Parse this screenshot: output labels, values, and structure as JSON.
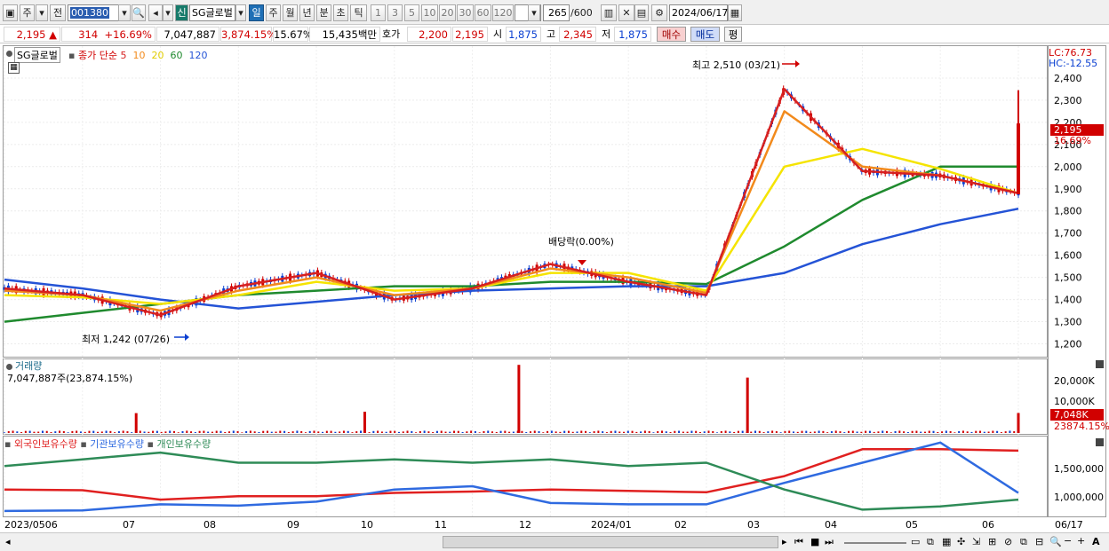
{
  "toolbar": {
    "mode_primary": "주",
    "mode_compare": "전",
    "stock_code": "001380",
    "new_badge": "신",
    "stock_name": "SG글로벌",
    "periods": [
      "일",
      "주",
      "월",
      "년",
      "분",
      "초",
      "틱"
    ],
    "active_period": "일",
    "intervals": [
      "1",
      "3",
      "5",
      "10",
      "20",
      "30",
      "60",
      "120"
    ],
    "count_value": "265",
    "count_total": "/600",
    "date": "2024/06/17"
  },
  "quote": {
    "price": "2,195",
    "change": "314",
    "change_pct": "+16.69%",
    "volume": "7,047,887",
    "volume_pct": "3,874.15%",
    "turnover": "15.67%",
    "amount": "15,435백만",
    "bid_label": "호가",
    "bid": "2,200",
    "ask": "2,195",
    "open_label": "시",
    "open": "1,875",
    "high_label": "고",
    "high": "2,345",
    "low_label": "저",
    "low": "1,875",
    "buy_label": "매수",
    "sell_label": "매도",
    "eval_label": "평"
  },
  "price_pane": {
    "legend_name": "SG글로벌",
    "legend_type": "종가 단순",
    "ma_periods": [
      "5",
      "10",
      "20",
      "60",
      "120"
    ],
    "lc": "LC:76.73",
    "hc": "HC:-12.55",
    "last_price_tag": "2,195",
    "last_pct_tag": "16.69%",
    "annot_high": "최고 2,510 (03/21)",
    "annot_low": "최저 1,242 (07/26)",
    "annot_div": "배당락(0.00%)"
  },
  "volume_pane": {
    "title": "거래량",
    "value": "7,047,887주(23,874.15%)",
    "axis": [
      "20,000K",
      "10,000K"
    ],
    "last_tag": "7,048K",
    "last_pct_tag": "23874.15%"
  },
  "holding_pane": {
    "legend": [
      "외국인보유수량",
      "기관보유수량",
      "개인보유수량"
    ],
    "axis": [
      "1,500,000",
      "1,000,000"
    ]
  },
  "date_axis": [
    "2023/0506",
    "07",
    "08",
    "09",
    "10",
    "11",
    "12",
    "2024/01",
    "02",
    "03",
    "04",
    "05",
    "06",
    "06/17"
  ],
  "colors": {
    "up": "#d10000",
    "down": "#0a3fd1",
    "ma5": "#d62020",
    "ma10": "#f28a1c",
    "ma20": "#f5e400",
    "ma60": "#1f8a2e",
    "ma120": "#2453d6",
    "foreign": "#e02020",
    "institution": "#2f6ae0",
    "individual": "#2e8b57"
  },
  "chart_data": [
    {
      "type": "line",
      "title": "SG글로벌",
      "ylim": [
        1150,
        2520
      ],
      "yticks": [
        1200,
        1300,
        1400,
        1500,
        1600,
        1700,
        1800,
        1900,
        2000,
        2100,
        2200,
        2300,
        2400
      ],
      "x": [
        "2023-05",
        "2023-06",
        "2023-07",
        "2023-08",
        "2023-09",
        "2023-10",
        "2023-11",
        "2023-12",
        "2024-01",
        "2024-02",
        "2024-03",
        "2024-04",
        "2024-05",
        "2024-06"
      ],
      "series": [
        {
          "name": "5",
          "values": [
            1450,
            1420,
            1330,
            1460,
            1520,
            1400,
            1450,
            1560,
            1480,
            1420,
            2350,
            1980,
            1960,
            1880
          ]
        },
        {
          "name": "10",
          "values": [
            1440,
            1420,
            1350,
            1440,
            1500,
            1420,
            1450,
            1540,
            1500,
            1430,
            2250,
            2000,
            1960,
            1880
          ]
        },
        {
          "name": "20",
          "values": [
            1420,
            1410,
            1380,
            1420,
            1480,
            1440,
            1450,
            1520,
            1520,
            1440,
            2000,
            2080,
            1990,
            1880
          ]
        },
        {
          "name": "60",
          "values": [
            1300,
            1340,
            1380,
            1420,
            1440,
            1460,
            1460,
            1480,
            1480,
            1470,
            1640,
            1850,
            2000,
            2000
          ]
        },
        {
          "name": "120",
          "values": [
            1490,
            1450,
            1400,
            1360,
            1390,
            1420,
            1440,
            1450,
            1460,
            1460,
            1520,
            1650,
            1740,
            1810
          ]
        }
      ],
      "high": {
        "value": 2510,
        "date": "03/21"
      },
      "low": {
        "value": 1242,
        "date": "07/26"
      },
      "last": 2195
    },
    {
      "type": "bar",
      "title": "거래량",
      "ylim": [
        0,
        25000
      ],
      "unit": "K",
      "spikes": [
        {
          "x": "2023-06-28",
          "value": 7000
        },
        {
          "x": "2023-09-28",
          "value": 7500
        },
        {
          "x": "2023-11-29",
          "value": 24000
        },
        {
          "x": "2024-02-29",
          "value": 19500
        },
        {
          "x": "2024-06-17",
          "value": 7048
        }
      ]
    },
    {
      "type": "line",
      "title": "보유수량",
      "ylim": [
        700000,
        1850000
      ],
      "x": [
        "2023-05",
        "2023-06",
        "2023-07",
        "2023-08",
        "2023-09",
        "2023-10",
        "2023-11",
        "2023-12",
        "2024-01",
        "2024-02",
        "2024-03",
        "2024-04",
        "2024-05",
        "2024-06"
      ],
      "series": [
        {
          "name": "외국인보유수량",
          "values": [
            1100000,
            1090000,
            950000,
            1000000,
            1000000,
            1050000,
            1070000,
            1100000,
            1080000,
            1060000,
            1300000,
            1700000,
            1700000,
            1680000
          ]
        },
        {
          "name": "기관보유수량",
          "values": [
            780000,
            790000,
            880000,
            860000,
            920000,
            1100000,
            1150000,
            900000,
            880000,
            880000,
            1200000,
            1500000,
            1800000,
            1050000
          ]
        },
        {
          "name": "개인보유수량",
          "values": [
            1450000,
            1550000,
            1650000,
            1500000,
            1500000,
            1550000,
            1500000,
            1550000,
            1450000,
            1500000,
            1100000,
            800000,
            850000,
            950000
          ]
        }
      ]
    }
  ]
}
